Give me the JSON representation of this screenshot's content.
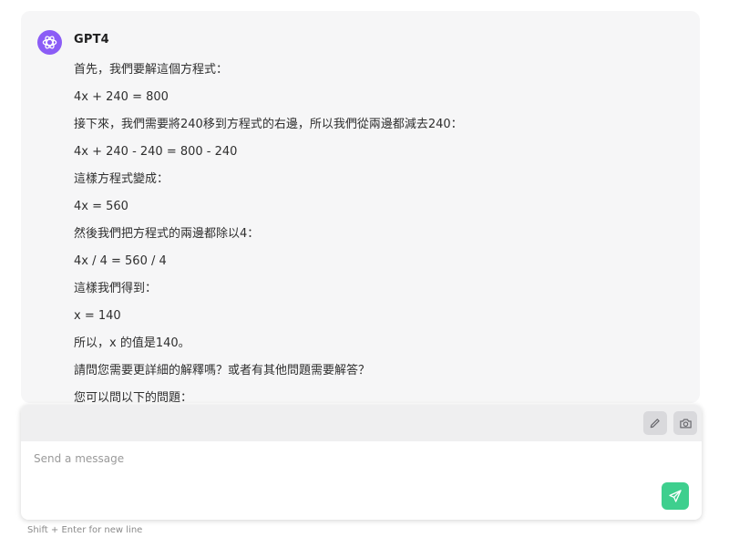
{
  "chat": {
    "sender_name": "GPT4",
    "message_lines": [
      "首先，我們要解這個方程式：",
      "4x + 240 = 800",
      "接下來，我們需要將240移到方程式的右邊，所以我們從兩邊都減去240：",
      "4x + 240 - 240 = 800 - 240",
      "這樣方程式變成：",
      "4x = 560",
      "然後我們把方程式的兩邊都除以4：",
      "4x / 4 = 560 / 4",
      "這樣我們得到：",
      "x = 140",
      "所以，x 的值是140。",
      "請問您需要更詳細的解釋嗎？或者有其他問題需要解答？",
      "您可以問以下的問題："
    ]
  },
  "composer": {
    "placeholder": "Send a message",
    "hint": "Shift + Enter for new line",
    "icons": {
      "attach": "pencil-icon",
      "camera": "camera-icon",
      "send": "send-icon"
    }
  },
  "colors": {
    "avatar": "#8b5cf6",
    "send_button": "#3ecf8e",
    "chat_background": "#f6f6f7"
  }
}
